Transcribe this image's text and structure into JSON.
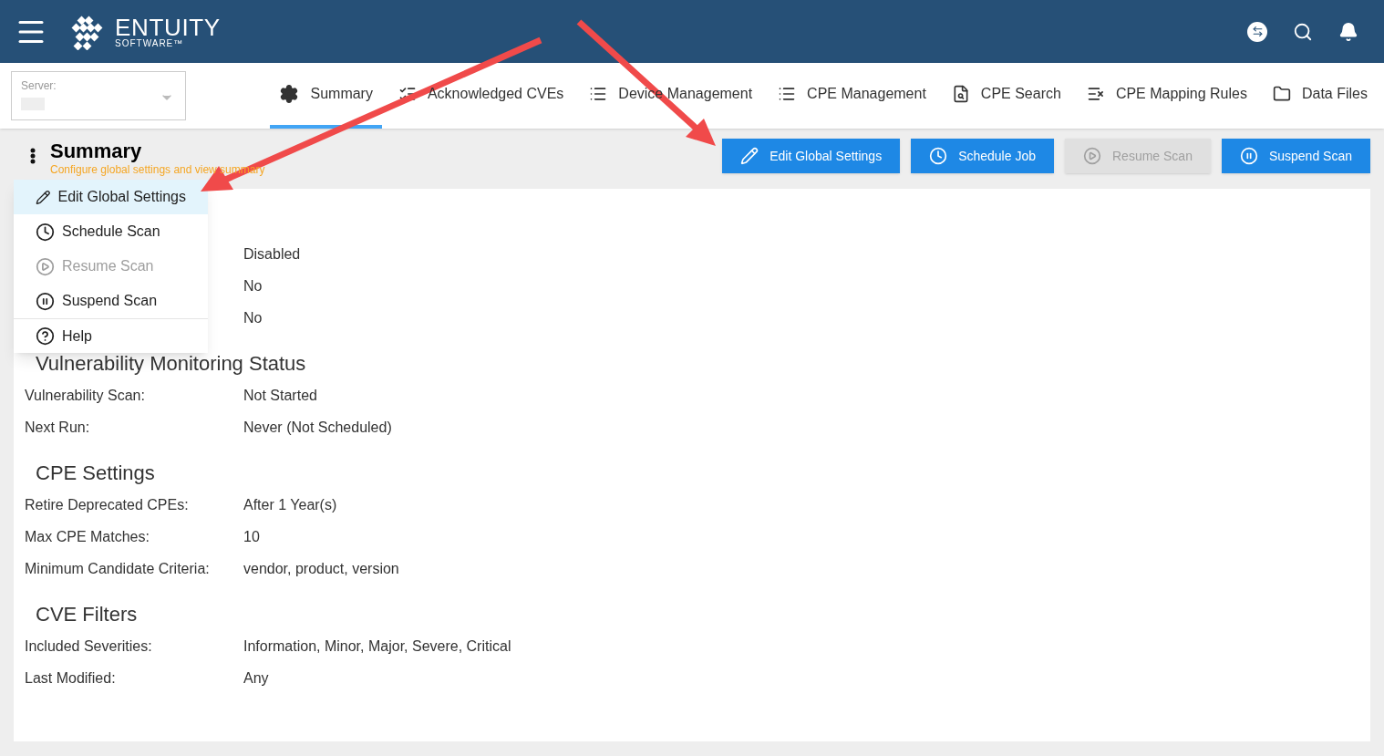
{
  "header": {
    "logo_name": "ENTUITY",
    "logo_sub": "SOFTWARE™"
  },
  "server": {
    "label": "Server:"
  },
  "tabs": [
    {
      "label": "Summary",
      "selected": true
    },
    {
      "label": "Acknowledged CVEs",
      "selected": false
    },
    {
      "label": "Device Management",
      "selected": false
    },
    {
      "label": "CPE Management",
      "selected": false
    },
    {
      "label": "CPE Search",
      "selected": false
    },
    {
      "label": "CPE Mapping Rules",
      "selected": false
    },
    {
      "label": "Data Files",
      "selected": false
    }
  ],
  "page": {
    "title": "Summary",
    "subtitle": "Configure global settings and view summary"
  },
  "actions": [
    {
      "label": "Edit Global Settings",
      "disabled": false
    },
    {
      "label": "Schedule Job",
      "disabled": false
    },
    {
      "label": "Resume Scan",
      "disabled": true
    },
    {
      "label": "Suspend Scan",
      "disabled": false
    }
  ],
  "menu": [
    {
      "label": "Edit Global Settings",
      "disabled": false,
      "selected": true
    },
    {
      "label": "Schedule Scan",
      "disabled": false,
      "selected": false
    },
    {
      "label": "Resume Scan",
      "disabled": true,
      "selected": false
    },
    {
      "label": "Suspend Scan",
      "disabled": false,
      "selected": false
    },
    {
      "label": "Help",
      "disabled": false,
      "selected": false
    }
  ],
  "sections": [
    {
      "rows": [
        {
          "value": "Disabled"
        },
        {
          "value": "No"
        },
        {
          "value": "No"
        }
      ]
    },
    {
      "title": "Vulnerability Monitoring Status",
      "rows": [
        {
          "label": "Vulnerability Scan:",
          "value": "Not Started"
        },
        {
          "label": "Next Run:",
          "value": "Never (Not Scheduled)"
        }
      ]
    },
    {
      "title": "CPE Settings",
      "rows": [
        {
          "label": "Retire Deprecated CPEs:",
          "value": "After 1 Year(s)"
        },
        {
          "label": "Max CPE Matches:",
          "value": "10"
        },
        {
          "label": "Minimum Candidate Criteria:",
          "value": "vendor, product, version"
        }
      ]
    },
    {
      "title": "CVE Filters",
      "rows": [
        {
          "label": "Included Severities:",
          "value": "Information, Minor, Major, Severe, Critical"
        },
        {
          "label": "Last Modified:",
          "value": "Any"
        }
      ]
    }
  ]
}
